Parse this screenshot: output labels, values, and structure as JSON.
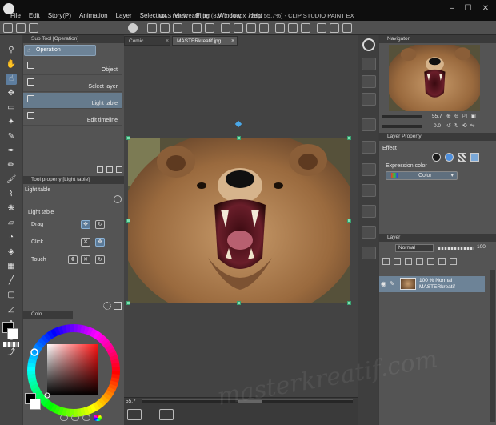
{
  "window": {
    "title": "MASTERkreatif.jpg (824 x 618px 72dpi 55.7%)  - CLIP STUDIO PAINT EX",
    "minimize_glyph": "–",
    "maximize_glyph": "☐",
    "close_glyph": "✕"
  },
  "menu": [
    "File",
    "Edit",
    "Story(P)",
    "Animation",
    "Layer",
    "Selection",
    "View",
    "Filter",
    "Window",
    "Help"
  ],
  "doc_tabs": [
    "Comic",
    "MASTERkreatif.jpg"
  ],
  "sub_tool": {
    "tab_label": "Sub Tool [Operation]",
    "header": "Operation",
    "items": [
      {
        "label": "Object",
        "selected": false
      },
      {
        "label": "Select layer",
        "selected": false
      },
      {
        "label": "Light table",
        "selected": true
      },
      {
        "label": "Edit timeline",
        "selected": false
      }
    ]
  },
  "tool_property": {
    "tab_label": "Tool property [Light table]",
    "title": "Light table",
    "section_label": "Light table",
    "rows": [
      "Drag",
      "Click",
      "Touch"
    ]
  },
  "color": {
    "tab_label": "Colo",
    "main_color": "#000000",
    "sub_color": "#ffffff",
    "hue_marker_color": "#e03030"
  },
  "navigator": {
    "tab_label": "Navigator",
    "zoom": "55.7",
    "rotation": "0.0"
  },
  "layer_property": {
    "tab_label": "Layer Property",
    "effect_label": "Effect",
    "expression_label": "Expression color",
    "expression_value": "Color"
  },
  "layer_panel": {
    "tab_label": "Layer",
    "blend_mode": "Normal",
    "opacity": "100",
    "layers": [
      {
        "opacity_mode": "100 % Normal",
        "name": "MASTERkreatif",
        "selected": true
      }
    ]
  },
  "canvas_status": {
    "zoom": "55.7"
  },
  "watermark": "masterkreatif.com",
  "colors": {
    "accent_selection": "#667b8d",
    "handle": "#7ee0b0",
    "rotation_handle": "#4aa8e8"
  }
}
